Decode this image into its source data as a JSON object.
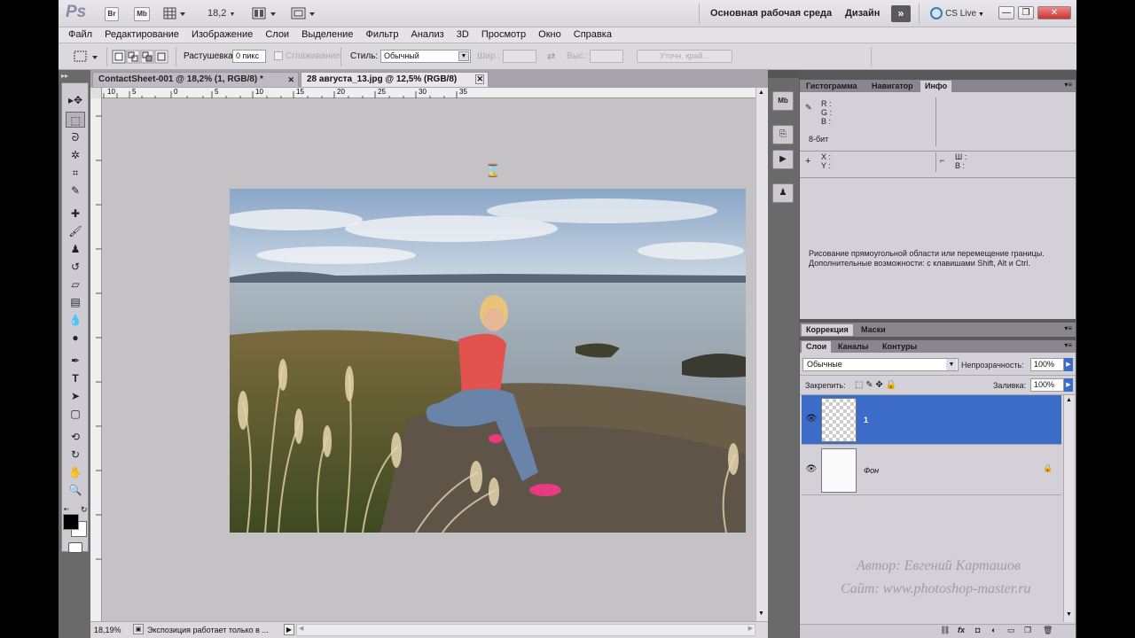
{
  "app": {
    "logo": "Ps",
    "btn_bridge": "Br",
    "btn_minibridge": "Mb",
    "zoom": "18,2",
    "workspace_main": "Основная рабочая среда",
    "workspace_design": "Дизайн",
    "cs_live": "CS Live",
    "win_minimize": "—",
    "win_restore": "❐",
    "win_close": "✕"
  },
  "menu": [
    "Файл",
    "Редактирование",
    "Изображение",
    "Слои",
    "Выделение",
    "Фильтр",
    "Анализ",
    "3D",
    "Просмотр",
    "Окно",
    "Справка"
  ],
  "options": {
    "feather_label": "Растушевка:",
    "feather_value": "0 пикс",
    "antialias_label": "Сглаживание",
    "style_label": "Стиль:",
    "style_value": "Обычный",
    "width_label": "Шир.:",
    "height_label": "Выс.:",
    "refine_label": "Уточн. край..."
  },
  "doc": {
    "tab1": "ContactSheet-001 @ 18,2% (1, RGB/8) *",
    "tab2": "28 августа_13.jpg @ 12,5% (RGB/8)",
    "close_glyph": "✕",
    "ruler_labels": [
      "10",
      "5",
      "0",
      "5",
      "10",
      "15",
      "20",
      "25",
      "30",
      "35"
    ],
    "status_zoom": "18,19%",
    "status_text": "Экспозиция работает только в ..."
  },
  "info_panel": {
    "tabs": [
      "Гистограмма",
      "Навигатор",
      "Инфо"
    ],
    "r": "R :",
    "g": "G :",
    "b": "B :",
    "bit": "8-бит",
    "x": "X :",
    "y": "Y :",
    "w": "Ш :",
    "h": "В :",
    "hint_line1": "Рисование прямоугольной области или перемещение границы.",
    "hint_line2": "Дополнительные возможности: с клавишами Shift, Alt и Ctrl."
  },
  "adjust_panel": {
    "tabs": [
      "Коррекция",
      "Маски"
    ]
  },
  "layers_panel": {
    "tabs": [
      "Слои",
      "Каналы",
      "Контуры"
    ],
    "blend_mode": "Обычные",
    "opacity_label": "Непрозрачность:",
    "opacity_value": "100%",
    "lock_label": "Закрепить:",
    "fill_label": "Заливка:",
    "fill_value": "100%",
    "layers": [
      {
        "name": "1",
        "selected": true
      },
      {
        "name": "Фон",
        "selected": false
      }
    ],
    "footer_icons": [
      "link-icon",
      "fx-icon",
      "mask-icon",
      "adjustment-icon",
      "folder-icon",
      "new-layer-icon",
      "trash-icon"
    ]
  },
  "watermark": {
    "line1": "Автор: Евгений Карташов",
    "line2": "Сайт: www.photoshop-master.ru"
  },
  "colors": {
    "selection": "#3d6bc8",
    "panel": "#d4d0d8",
    "chrome_dark": "#6a6a6a"
  }
}
